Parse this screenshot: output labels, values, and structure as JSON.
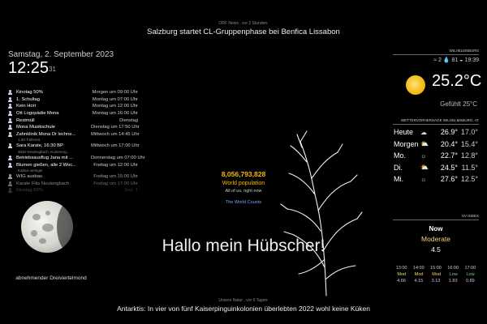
{
  "news_top": {
    "source": "ORF News , vor 2 Stunden:",
    "headline": "Salzburg startet CL-Gruppenphase bei Benfica Lissabon"
  },
  "clock": {
    "date": "Samstag, 2. September 2023",
    "time": "12:25",
    "seconds": "31"
  },
  "calendar": [
    {
      "title": "Kinotag 50%",
      "when": "Morgen um 09:00 Uhr",
      "sub": ""
    },
    {
      "title": "1. Schultag",
      "when": "Montag um 07:00 Uhr",
      "sub": ""
    },
    {
      "title": "Kein Hort",
      "when": "Montag um 12:00 Uhr",
      "sub": ""
    },
    {
      "title": "Ott Logopädie Mona",
      "when": "Montag um 16:00 Uhr",
      "sub": ""
    },
    {
      "title": "Restmüll",
      "when": "Dienstag",
      "sub": ""
    },
    {
      "title": "Mona Musikschule",
      "when": "Dienstag um 17:50 Uhr",
      "sub": ""
    },
    {
      "title": "Zahnklinik Mona Dr lechne...",
      "when": "Mittwoch um 14:45 Uhr",
      "sub": "1,3H Fahrzeit"
    },
    {
      "title": "Sara Karate, 16:30 BP",
      "when": "Mittwoch um 17:00 Uhr",
      "sub": "3040 Neulengbach, Kummerg..."
    },
    {
      "title": "Betriebsausflug Jana mit ...",
      "when": "Donnerstag um 07:00 Uhr",
      "sub": ""
    },
    {
      "title": "Blumen gießen, alle 2 Woc...",
      "when": "Freitag um 12:00 Uhr",
      "sub": "Kaktus weniger"
    },
    {
      "title": "WIG ausbau",
      "when": "Freitag um 15:00 Uhr",
      "sub": ""
    },
    {
      "title": "Karate Fitis Neulengbach",
      "when": "Freitag um 17:00 Uhr",
      "sub": ""
    },
    {
      "title": "Kinotag 50%",
      "when": "Sep. 1",
      "sub": ""
    }
  ],
  "moon": {
    "label": "abnehmender Dreiviertelmond"
  },
  "world": {
    "count": "8,056,793,828",
    "label": "World population",
    "sub": "All of us, right now",
    "link": "The World Counts"
  },
  "compliment": "Hallo mein Hübscher!",
  "news_bottom": {
    "source": "Unsere Natur , vor 9 Tagen:",
    "headline": "Antarktis: In vier von fünf Kaiserpinguinkolonien überlebten 2022 wohl keine Küken"
  },
  "current_weather": {
    "header": "WILHELMSBURG",
    "wind": "2",
    "humidity": "81",
    "sunset": "19:39",
    "temp": "25.2°C",
    "feels": "Gefühlt 25°C"
  },
  "forecast": {
    "header": "WETTERVORHERSAGE WILHELMSBURG, AT",
    "days": [
      {
        "day": "Heute",
        "icon": "cloud-rain-icon",
        "glyph": "☁",
        "hi": "26.9°",
        "lo": "17.0°"
      },
      {
        "day": "Morgen",
        "icon": "cloud-sun-icon",
        "glyph": "⛅",
        "hi": "20.4°",
        "lo": "15.4°"
      },
      {
        "day": "Mo.",
        "icon": "sun-icon",
        "glyph": "☼",
        "hi": "22.7°",
        "lo": "12.8°"
      },
      {
        "day": "Di.",
        "icon": "cloud-sun-icon",
        "glyph": "⛅",
        "hi": "24.5°",
        "lo": "11.5°"
      },
      {
        "day": "Mi.",
        "icon": "sun-icon",
        "glyph": "☼",
        "hi": "27.6°",
        "lo": "12.5°"
      }
    ]
  },
  "uv": {
    "header": "UV INDEX",
    "now_label": "Now",
    "level": "Moderate",
    "value": "4.5",
    "hours": [
      "13:00",
      "14:00",
      "15:00",
      "16:00",
      "17:00"
    ],
    "levels": [
      "Mod",
      "Mod",
      "Mod",
      "Low",
      "Low"
    ],
    "values": [
      "4.66",
      "4.15",
      "3.13",
      "1.83",
      "0.89"
    ],
    "colors": {
      "Mod": "#f5d97a",
      "Low": "#7ad07a"
    }
  }
}
